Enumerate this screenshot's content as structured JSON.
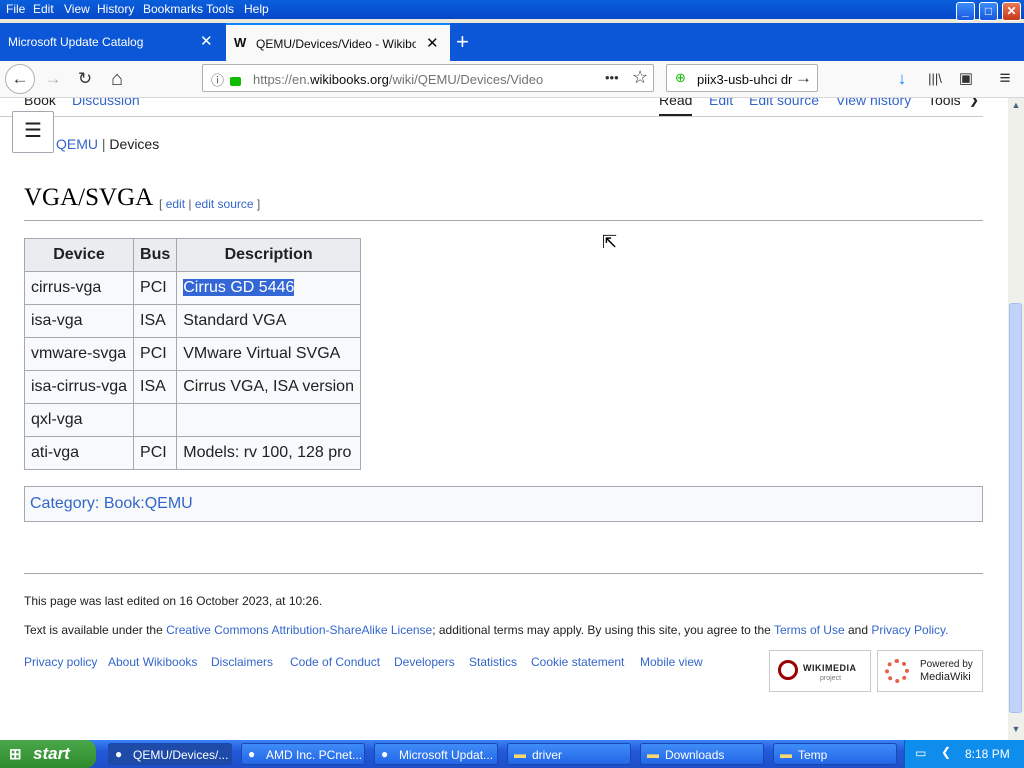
{
  "menubar": {
    "items": [
      "File",
      "Edit",
      "View",
      "History",
      "Bookmarks",
      "Tools",
      "Help"
    ]
  },
  "window_buttons": {
    "minimize": "_",
    "maximize": "□",
    "close": "✕"
  },
  "tabs": [
    {
      "title": "Microsoft Update Catalog",
      "active": false
    },
    {
      "title": "QEMU/Devices/Video - Wikibooks, o",
      "active": true
    }
  ],
  "toolbar": {
    "back": "←",
    "forward": "→",
    "reload": "↻",
    "home": "⌂",
    "url_prefix": "https://en.",
    "url_domain": "wikibooks.org",
    "url_path": "/wiki/QEMU/Devices/Video",
    "page_actions": "•••",
    "bookmark_star": "☆",
    "search_value": "piix3-usb-uhci dr",
    "search_go": "→",
    "downloads": "↓",
    "library": "|||\\",
    "sidebar": "▣",
    "menu": "≡"
  },
  "wiki": {
    "tab_book": "Book",
    "tab_discussion": "Discussion",
    "tab_read": "Read",
    "tab_edit": "Edit",
    "tab_edit_source": "Edit source",
    "tab_view_history": "View history",
    "tab_tools": "Tools",
    "breadcrumb_parent": "QEMU",
    "breadcrumb_sep": "|",
    "breadcrumb_current": "Devices",
    "heading": "VGA/SVGA",
    "edit_open": "[",
    "edit_link": "edit",
    "edit_sep": "|",
    "edit_source_link": "edit source",
    "edit_close": "]",
    "table": {
      "headers": [
        "Device",
        "Bus",
        "Description"
      ],
      "rows": [
        [
          "cirrus-vga",
          "PCI",
          "Cirrus GD 5446"
        ],
        [
          "isa-vga",
          "ISA",
          "Standard VGA"
        ],
        [
          "vmware-svga",
          "PCI",
          "VMware Virtual SVGA"
        ],
        [
          "isa-cirrus-vga",
          "ISA",
          "Cirrus VGA, ISA version"
        ],
        [
          "qxl-vga",
          "",
          ""
        ],
        [
          "ati-vga",
          "PCI",
          "Models: rv 100, 128 pro"
        ]
      ]
    },
    "category": "Category: Book:QEMU"
  },
  "footer": {
    "last_edited": "This page was last edited on 16 October 2023, at 10:26.",
    "license_pre": "Text is available under the ",
    "license_link": "Creative Commons Attribution-ShareAlike License",
    "license_mid": "; additional terms may apply. By using this site, you agree to the ",
    "terms_link": "Terms of Use",
    "and": " and ",
    "privacy_link": "Privacy Policy.",
    "links": [
      "Privacy policy",
      "About Wikibooks",
      "Disclaimers",
      "Code of Conduct",
      "Developers",
      "Statistics",
      "Cookie statement",
      "Mobile view"
    ],
    "wikimedia_badge": "WIKIMEDIA",
    "wikimedia_sub": "project",
    "mediawiki_badge_top": "Powered by",
    "mediawiki_badge_bottom": "MediaWiki"
  },
  "taskbar": {
    "start": "start",
    "buttons": [
      {
        "label": "QEMU/Devices/...",
        "active": true
      },
      {
        "label": "AMD Inc. PCnet...",
        "active": false
      },
      {
        "label": "Microsoft Updat...",
        "active": false
      },
      {
        "label": "driver",
        "active": false
      },
      {
        "label": "Downloads",
        "active": false
      },
      {
        "label": "Temp",
        "active": false
      }
    ],
    "clock": "8:18 PM"
  },
  "colors": {
    "link": "#3366cc",
    "selection": "#3367d6",
    "taskbar": "#2258d8",
    "start": "#2e8b2e"
  }
}
